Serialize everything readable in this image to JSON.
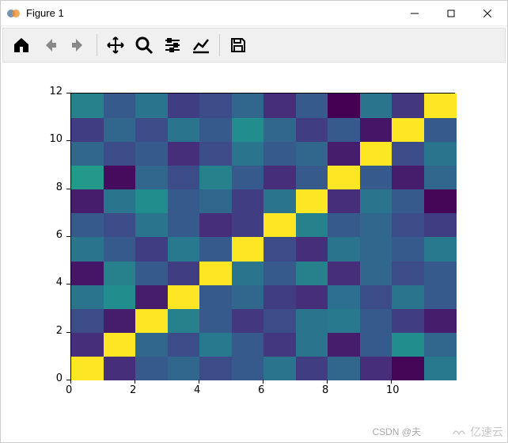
{
  "window": {
    "title": "Figure 1"
  },
  "toolbar": {
    "home": "Home",
    "back": "Back",
    "forward": "Forward",
    "pan": "Pan",
    "zoom": "Zoom",
    "subplots": "Configure subplots",
    "edit": "Edit axis",
    "save": "Save"
  },
  "watermarks": {
    "csdn": "CSDN @夫",
    "yisu": "亿速云"
  },
  "chart_data": {
    "type": "heatmap",
    "xlabel": "",
    "ylabel": "",
    "xlim": [
      0,
      12
    ],
    "ylim": [
      0,
      12
    ],
    "xticks": [
      0,
      2,
      4,
      6,
      8,
      10
    ],
    "yticks": [
      0,
      2,
      4,
      6,
      8,
      10,
      12
    ],
    "colormap": "viridis",
    "note": "12x12 matrix; diagonal = 1.0; off-diagonal values approx 0.0–0.55 (random-like)",
    "z": [
      [
        1.0,
        0.15,
        0.3,
        0.35,
        0.25,
        0.3,
        0.4,
        0.2,
        0.35,
        0.15,
        0.03,
        0.42
      ],
      [
        0.15,
        1.0,
        0.35,
        0.25,
        0.42,
        0.3,
        0.18,
        0.4,
        0.1,
        0.3,
        0.5,
        0.35
      ],
      [
        0.25,
        0.1,
        1.0,
        0.45,
        0.3,
        0.18,
        0.25,
        0.4,
        0.42,
        0.3,
        0.2,
        0.1
      ],
      [
        0.4,
        0.5,
        0.1,
        1.0,
        0.3,
        0.35,
        0.2,
        0.15,
        0.38,
        0.25,
        0.4,
        0.3
      ],
      [
        0.08,
        0.45,
        0.3,
        0.2,
        1.0,
        0.4,
        0.3,
        0.45,
        0.15,
        0.35,
        0.25,
        0.3
      ],
      [
        0.4,
        0.3,
        0.2,
        0.42,
        0.3,
        1.0,
        0.25,
        0.15,
        0.4,
        0.35,
        0.3,
        0.42
      ],
      [
        0.3,
        0.25,
        0.4,
        0.3,
        0.15,
        0.2,
        1.0,
        0.45,
        0.3,
        0.35,
        0.25,
        0.2
      ],
      [
        0.1,
        0.4,
        0.5,
        0.3,
        0.35,
        0.2,
        0.4,
        1.0,
        0.15,
        0.4,
        0.3,
        0.03
      ],
      [
        0.55,
        0.05,
        0.35,
        0.25,
        0.45,
        0.3,
        0.15,
        0.3,
        1.0,
        0.3,
        0.1,
        0.35
      ],
      [
        0.35,
        0.25,
        0.3,
        0.15,
        0.25,
        0.4,
        0.3,
        0.35,
        0.1,
        1.0,
        0.25,
        0.4
      ],
      [
        0.2,
        0.35,
        0.25,
        0.4,
        0.3,
        0.5,
        0.35,
        0.2,
        0.3,
        0.08,
        1.0,
        0.3
      ],
      [
        0.45,
        0.3,
        0.4,
        0.2,
        0.25,
        0.35,
        0.15,
        0.3,
        0.02,
        0.4,
        0.18,
        1.0
      ]
    ]
  }
}
